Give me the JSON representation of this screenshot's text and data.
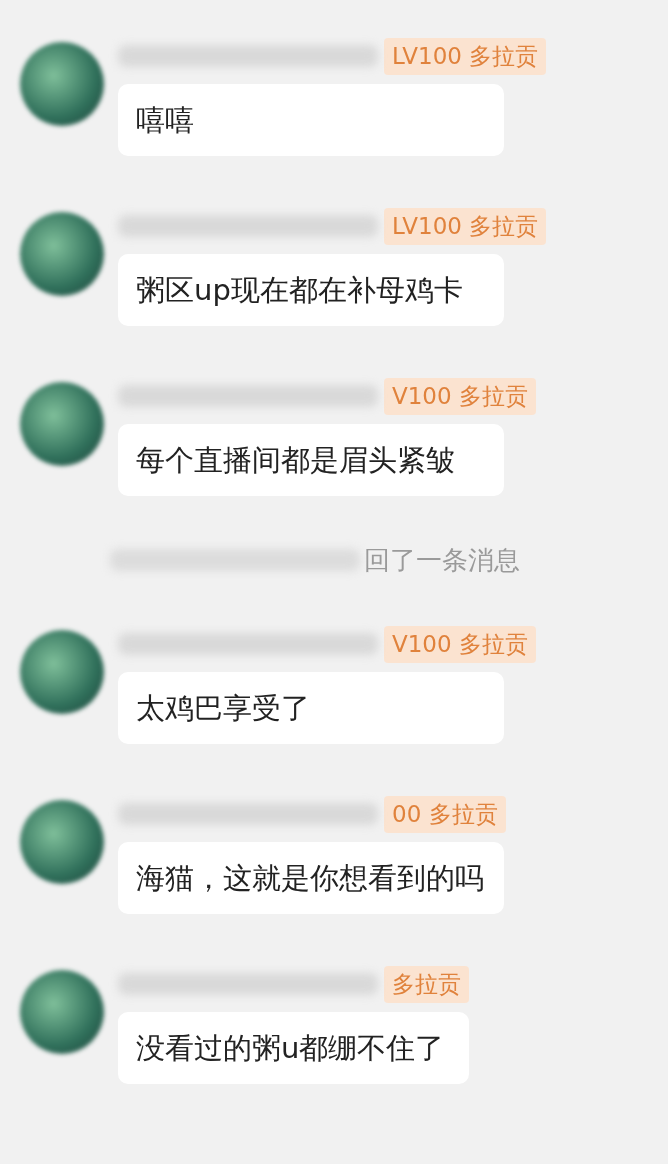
{
  "messages": [
    {
      "kind": "message",
      "badge": "LV100 多拉贡",
      "text": "嘻嘻"
    },
    {
      "kind": "message",
      "badge": "LV100 多拉贡",
      "text": "粥区up现在都在补母鸡卡"
    },
    {
      "kind": "message",
      "badge": "V100 多拉贡",
      "text": "每个直播间都是眉头紧皱"
    },
    {
      "kind": "notice",
      "text": "回了一条消息"
    },
    {
      "kind": "message",
      "badge": "V100 多拉贡",
      "text": "太鸡巴享受了"
    },
    {
      "kind": "message",
      "badge": "00 多拉贡",
      "text": "海猫，这就是你想看到的吗"
    },
    {
      "kind": "message",
      "badge": "多拉贡",
      "text": "没看过的粥u都绷不住了"
    }
  ]
}
